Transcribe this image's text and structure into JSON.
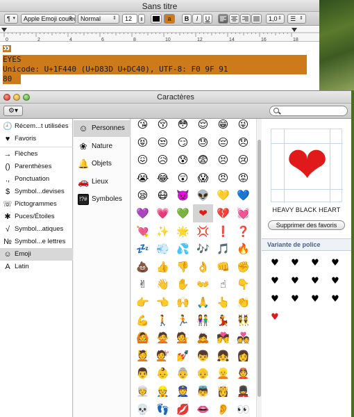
{
  "editor": {
    "title": "Sans titre",
    "toolbar": {
      "paragraph_btn": "¶",
      "font_family": "Apple Emoji couleur",
      "font_style": "Normal",
      "font_size": "12",
      "bold": "B",
      "italic": "I",
      "underline": "U",
      "line_spacing": "1,0",
      "text_color": "#000000",
      "highlight_color": "#cc7a1a",
      "highlight_label": "a"
    },
    "ruler_numbers": [
      "0",
      "2",
      "4",
      "6",
      "8",
      "10",
      "12",
      "14",
      "16",
      "18"
    ],
    "content": {
      "marker": "👀",
      "line1": "EYES",
      "line2": "Unicode: U+1F440 (U+D83D U+DC40), UTF-8: F0 9F 91",
      "line3": "80"
    }
  },
  "palette": {
    "title": "Caractères",
    "gear": "⚙▾",
    "search_placeholder": "",
    "sidebar": [
      {
        "icon": "🕘",
        "label": "Récem...t utilisées"
      },
      {
        "icon": "♥",
        "label": "Favoris"
      },
      {
        "icon": "→",
        "label": "Flèches"
      },
      {
        "icon": "()",
        "label": "Parenthèses"
      },
      {
        "icon": ".,",
        "label": "Ponctuation"
      },
      {
        "icon": "$",
        "label": "Symbol...devises"
      },
      {
        "icon": "☏",
        "label": "Pictogrammes"
      },
      {
        "icon": "✱",
        "label": "Puces/Étoiles"
      },
      {
        "icon": "√",
        "label": "Symbol...atiques"
      },
      {
        "icon": "№",
        "label": "Symbol...e lettres"
      },
      {
        "icon": "☺",
        "label": "Emoji",
        "active": true
      },
      {
        "icon": "A",
        "label": "Latin"
      }
    ],
    "categories": [
      {
        "icon": "☺",
        "label": "Personnes",
        "active": true
      },
      {
        "icon": "❀",
        "label": "Nature"
      },
      {
        "icon": "🔔",
        "label": "Objets"
      },
      {
        "icon": "🚗",
        "label": "Lieux"
      },
      {
        "icon": "!?#",
        "label": "Symboles"
      }
    ],
    "grid": [
      [
        "😘",
        "😚",
        "😳",
        "😌",
        "😁",
        "😜"
      ],
      [
        "😝",
        "😒",
        "😏",
        "😓",
        "😔",
        "😞"
      ],
      [
        "😖",
        "😥",
        "😰",
        "😨",
        "😣",
        "😢"
      ],
      [
        "😭",
        "😂",
        "😲",
        "😱",
        "😠",
        "😡"
      ],
      [
        "😪",
        "😷",
        "👿",
        "👽",
        "💛",
        "💙"
      ],
      [
        "💜",
        "💗",
        "💚",
        "❤",
        "💔",
        "💓"
      ],
      [
        "💘",
        "✨",
        "🌟",
        "💢",
        "❗",
        "❓"
      ],
      [
        "💤",
        "💨",
        "💦",
        "🎶",
        "🎵",
        "🔥"
      ],
      [
        "💩",
        "👍",
        "👎",
        "👌",
        "👊",
        "✊"
      ],
      [
        "✌",
        "👋",
        "✋",
        "👐",
        "☝",
        "👇"
      ],
      [
        "👉",
        "👈",
        "🙌",
        "🙏",
        "👆",
        "👏"
      ],
      [
        "💪",
        "🚶",
        "🏃",
        "👫",
        "💃",
        "👯"
      ],
      [
        "🙆",
        "🙅",
        "💁",
        "🙇",
        "💏",
        "💑"
      ],
      [
        "💆",
        "💇",
        "💅",
        "👦",
        "👧",
        "👩"
      ],
      [
        "👨",
        "👶",
        "👵",
        "👴",
        "👱",
        "👲"
      ],
      [
        "👳",
        "👷",
        "👮",
        "👼",
        "👸",
        "💂"
      ],
      [
        "💀",
        "👣",
        "💋",
        "👄",
        "👂",
        "👀"
      ]
    ],
    "selected_cell": {
      "row": 5,
      "col": 3
    },
    "info": {
      "preview_char": "❤",
      "char_name": "HEAVY BLACK HEART",
      "favorites_button": "Supprimer des favoris",
      "variant_header": "Variante de police",
      "variants": [
        "♥",
        "♥",
        "♥",
        "♥",
        "♥",
        "♥",
        "♥",
        "♥",
        "♥",
        "♥",
        "♥",
        "♥",
        "♥"
      ],
      "variant_last_color": "#e01a1a"
    }
  }
}
